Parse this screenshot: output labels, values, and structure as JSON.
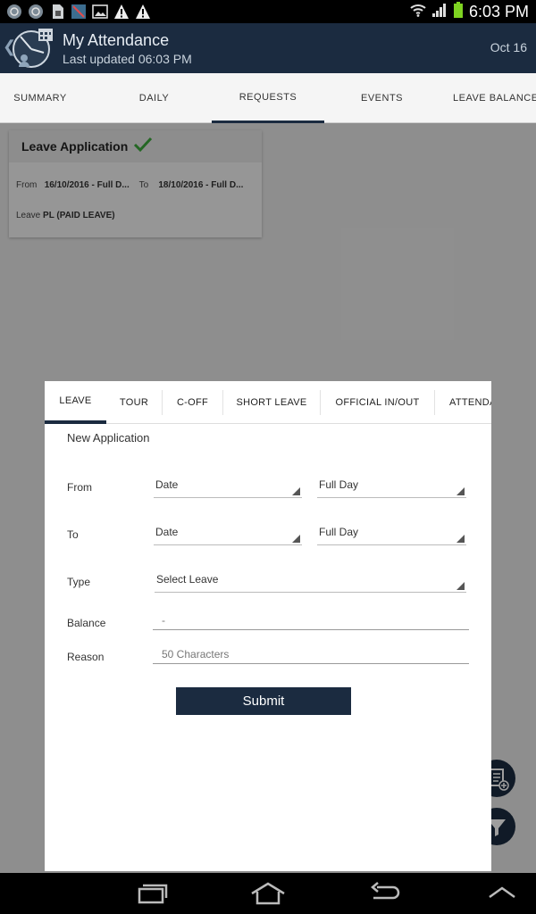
{
  "status_bar": {
    "time": "6:03 PM",
    "icons": [
      "sync-icon",
      "sync-icon",
      "sd-card-icon",
      "screenshot-icon",
      "image-icon",
      "warning-icon",
      "warning-icon"
    ],
    "right_icons": [
      "wifi-icon",
      "signal-icon",
      "battery-icon"
    ]
  },
  "app_bar": {
    "title": "My Attendance",
    "subtitle": "Last updated 06:03 PM",
    "date": "Oct 16"
  },
  "main_tabs": [
    {
      "label": "SUMMARY"
    },
    {
      "label": "DAILY"
    },
    {
      "label": "REQUESTS",
      "active": true
    },
    {
      "label": "EVENTS"
    },
    {
      "label": "LEAVE BALANCE"
    }
  ],
  "card": {
    "title": "Leave Application",
    "from_label": "From",
    "from_value": "16/10/2016 - Full D...",
    "to_label": "To",
    "to_value": "18/10/2016 - Full D...",
    "leave_label": "Leave",
    "leave_value": "PL (PAID LEAVE)"
  },
  "dialog": {
    "tabs": [
      {
        "label": "LEAVE",
        "active": true
      },
      {
        "label": "TOUR"
      },
      {
        "label": "C-OFF"
      },
      {
        "label": "SHORT LEAVE"
      },
      {
        "label": "OFFICIAL IN/OUT"
      },
      {
        "label": "ATTENDA"
      }
    ],
    "section_title": "New Application",
    "from": {
      "label": "From",
      "date": "Date",
      "day": "Full Day"
    },
    "to": {
      "label": "To",
      "date": "Date",
      "day": "Full Day"
    },
    "type": {
      "label": "Type",
      "value": "Select Leave"
    },
    "balance": {
      "label": "Balance",
      "value": "-"
    },
    "reason": {
      "label": "Reason",
      "placeholder": "50 Characters"
    },
    "submit": "Submit"
  },
  "colors": {
    "primary": "#1b2b40",
    "check": "#3aa63a"
  }
}
